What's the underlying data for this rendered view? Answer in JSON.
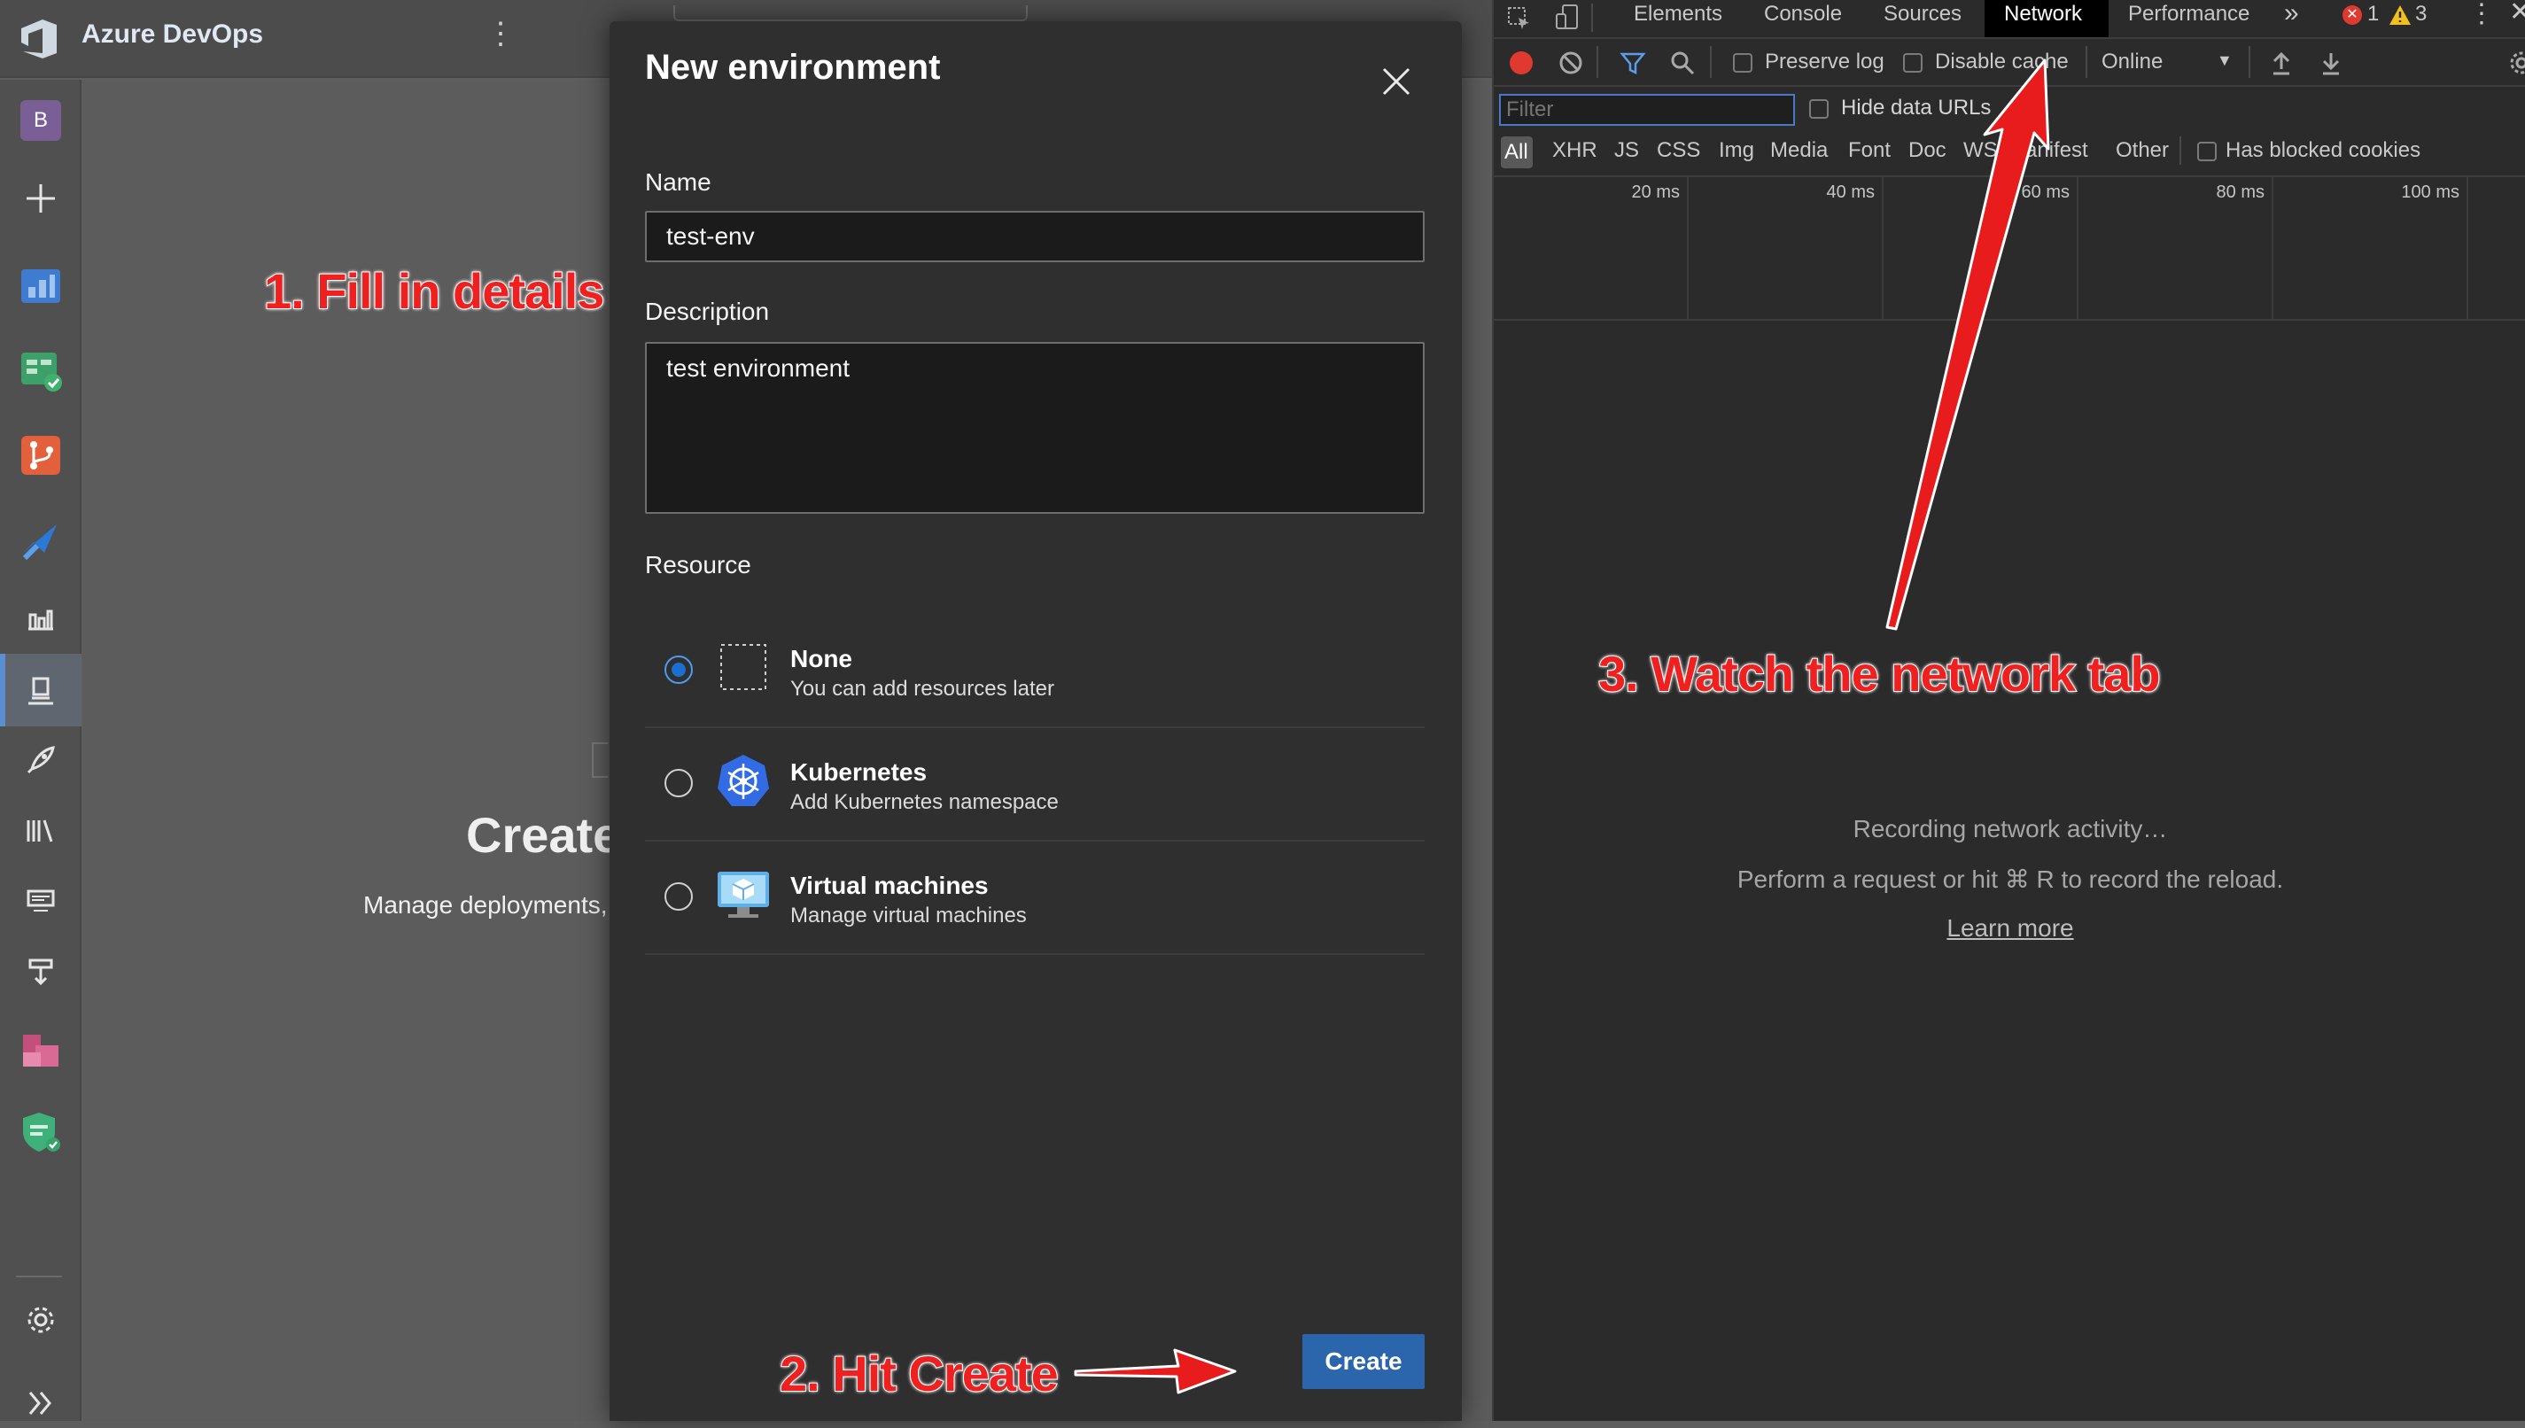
{
  "ado": {
    "title": "Azure DevOps",
    "org_initial": "B",
    "main_heading": "Create",
    "main_subtext": "Manage deployments,"
  },
  "modal": {
    "title": "New environment",
    "name_label": "Name",
    "name_value": "test-env",
    "description_label": "Description",
    "description_value": "test environment",
    "resource_label": "Resource",
    "resources": [
      {
        "name": "None",
        "description": "You can add resources later",
        "selected": true,
        "icon": "dashed-square-icon"
      },
      {
        "name": "Kubernetes",
        "description": "Add Kubernetes namespace",
        "selected": false,
        "icon": "kubernetes-icon"
      },
      {
        "name": "Virtual machines",
        "description": "Manage virtual machines",
        "selected": false,
        "icon": "virtual-machine-icon"
      }
    ],
    "create_label": "Create"
  },
  "devtools": {
    "tabs": [
      "Elements",
      "Console",
      "Sources",
      "Network",
      "Performance"
    ],
    "active_tab": "Network",
    "more_tabs": "»",
    "error_count": "1",
    "warning_count": "3",
    "preserve_log": "Preserve log",
    "disable_cache": "Disable cache",
    "throttling": "Online",
    "filter_placeholder": "Filter",
    "hide_data_urls": "Hide data URLs",
    "filter_types": [
      "All",
      "XHR",
      "JS",
      "CSS",
      "Img",
      "Media",
      "Font",
      "Doc",
      "WS",
      "Manifest",
      "Other"
    ],
    "has_blocked_cookies": "Has blocked cookies",
    "timeline_ticks": [
      "20 ms",
      "40 ms",
      "60 ms",
      "80 ms",
      "100 ms"
    ],
    "empty_line1": "Recording network activity…",
    "empty_line2": "Perform a request or hit ⌘ R to record the reload.",
    "learn_more": "Learn more"
  },
  "annotations": {
    "step1": "1. Fill in details",
    "step2": "2. Hit Create",
    "step3": "3. Watch the network tab"
  },
  "colors": {
    "primary_button": "#2b66ad",
    "annotation_red": "#ee2020",
    "radio_selected": "#1b6fd0"
  }
}
